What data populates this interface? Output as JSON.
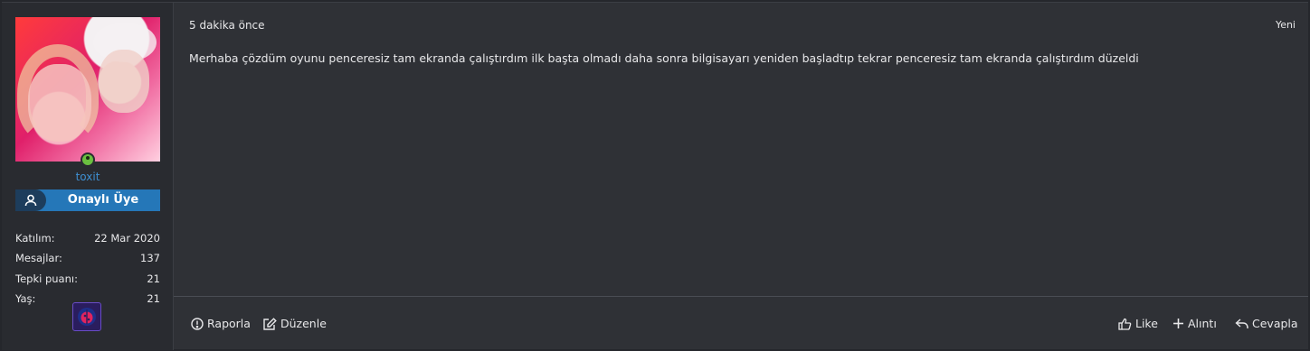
{
  "user": {
    "username": "toxit",
    "badge": "Onaylı Üye",
    "stats": [
      {
        "label": "Katılım:",
        "value": "22 Mar 2020"
      },
      {
        "label": "Mesajlar:",
        "value": "137"
      },
      {
        "label": "Tepki puanı:",
        "value": "21"
      },
      {
        "label": "Yaş:",
        "value": "21"
      }
    ]
  },
  "post": {
    "time": "5 dakika önce",
    "new_label": "Yeni",
    "message": "Merhaba çözdüm oyunu penceresiz tam ekranda çalıştırdım ilk başta olmadı daha sonra bilgisayarı yeniden başladtıp tekrar penceresiz tam ekranda çalıştırdım düzeldi"
  },
  "actions": {
    "report": "Raporla",
    "edit": "Düzenle",
    "like": "Like",
    "quote": "Alıntı",
    "reply": "Cevapla"
  },
  "colors": {
    "username": "#3e8fd1",
    "badge": "#2577b8",
    "online": "#6abf40"
  },
  "icons": {
    "report": "info-circle-icon",
    "edit": "edit-icon",
    "like": "thumbs-up-icon",
    "quote": "plus-icon",
    "reply": "reply-icon"
  }
}
